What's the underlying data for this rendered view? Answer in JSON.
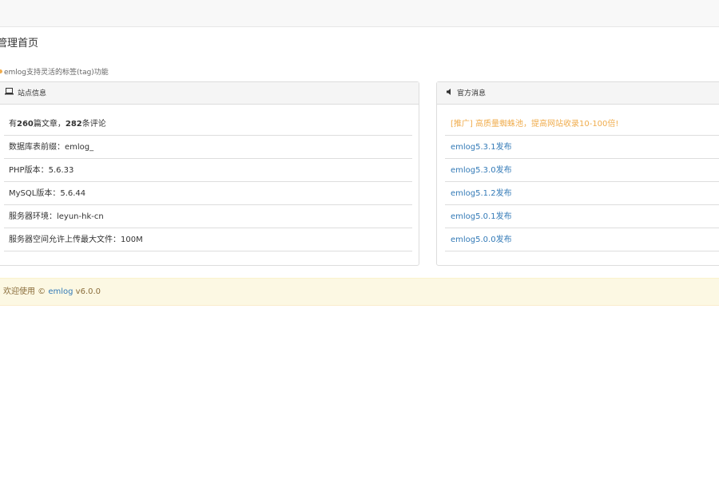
{
  "page": {
    "title": "管理首页",
    "tip": "emlog支持灵活的标签(tag)功能"
  },
  "site_info": {
    "heading": "站点信息",
    "stats_prefix": "有",
    "article_count": "260",
    "stats_mid": "篇文章，",
    "comment_count": "282",
    "stats_suffix": "条评论",
    "items": [
      "数据库表前缀：emlog_",
      "PHP版本：5.6.33",
      "MySQL版本：5.6.44",
      "服务器环境：leyun-hk-cn",
      "服务器空间允许上传最大文件：100M"
    ]
  },
  "news": {
    "heading": "官方消息",
    "items": [
      "[推广] 高质量蜘蛛池，提高网站收录10-100倍!",
      "emlog5.3.1发布",
      "emlog5.3.0发布",
      "emlog5.1.2发布",
      "emlog5.0.1发布",
      "emlog5.0.0发布"
    ]
  },
  "footer": {
    "prefix": "欢迎使用 © ",
    "link": "emlog",
    "version": " v6.0.0"
  },
  "colors": {
    "link": "#337ab7",
    "promo": "#f0ad4e",
    "footer_bg": "#fcf8e3"
  }
}
